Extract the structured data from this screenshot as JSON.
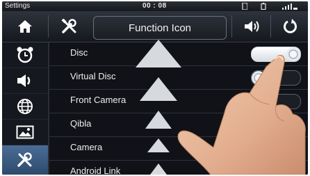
{
  "statusbar": {
    "title": "Settings",
    "clock": "00 : 08",
    "icons": [
      "sd-card-icon",
      "battery-icon",
      "signal-icon"
    ]
  },
  "navbar": {
    "home_icon": "home-icon",
    "tools_icon": "tools-icon",
    "title": "Function Icon",
    "volume_icon": "volume-icon",
    "refresh_icon": "refresh-icon"
  },
  "sidebar": {
    "items": [
      {
        "icon": "alarm-clock-icon",
        "active": false
      },
      {
        "icon": "speaker-icon",
        "active": false
      },
      {
        "icon": "globe-icon",
        "active": false
      },
      {
        "icon": "picture-icon",
        "active": false
      },
      {
        "icon": "tools-icon",
        "active": true
      }
    ]
  },
  "list": {
    "rows": [
      {
        "label": "Disc",
        "on": true
      },
      {
        "label": "Virtual Disc",
        "on": false
      },
      {
        "label": "Front Camera",
        "on": false
      },
      {
        "label": "Qibla",
        "on": false
      },
      {
        "label": "Camera",
        "on": true
      },
      {
        "label": "Android Link",
        "on": false
      }
    ]
  },
  "colors": {
    "active_sidebar": "#3d5f86",
    "background": "#101218",
    "text": "#eeeeee"
  }
}
